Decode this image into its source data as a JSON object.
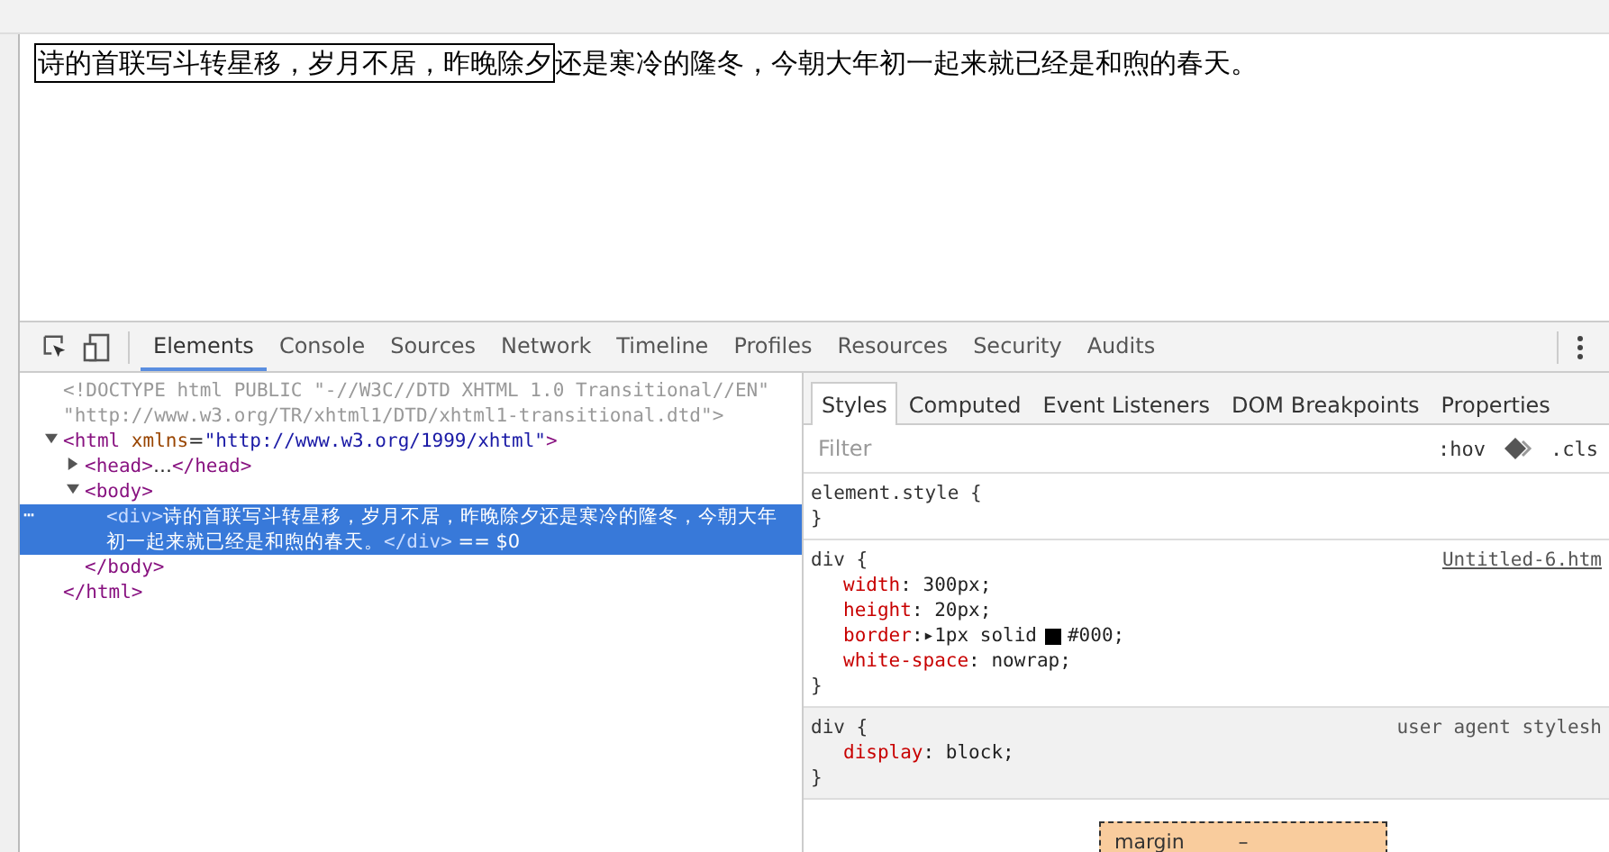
{
  "page": {
    "boxed_text": "诗的首联写斗转星移，岁月不居，昨晚除夕",
    "overflow_text": "还是寒冷的隆冬，今朝大年初一起来就已经是和煦的春天。"
  },
  "devtools": {
    "tabs": [
      {
        "label": "Elements",
        "selected": true
      },
      {
        "label": "Console",
        "selected": false
      },
      {
        "label": "Sources",
        "selected": false
      },
      {
        "label": "Network",
        "selected": false
      },
      {
        "label": "Timeline",
        "selected": false
      },
      {
        "label": "Profiles",
        "selected": false
      },
      {
        "label": "Resources",
        "selected": false
      },
      {
        "label": "Security",
        "selected": false
      },
      {
        "label": "Audits",
        "selected": false
      }
    ],
    "dom": [
      {
        "kind": "doctype",
        "segments": [
          {
            "kind": "doctype",
            "text": "<!DOCTYPE html PUBLIC \"-//W3C//DTD XHTML 1.0 Transitional//EN\" \"http://www.w3.org/TR/xhtml1/DTD/xhtml1-transitional.dtd\">"
          }
        ]
      },
      {
        "kind": "element",
        "expanded": true,
        "selected": false,
        "segments": [
          {
            "kind": "tag",
            "text": "<html"
          },
          {
            "kind": "attr",
            "text": " xmlns"
          },
          {
            "kind": "plain",
            "text": "="
          },
          {
            "kind": "value",
            "text": "\"http://www.w3.org/1999/xhtml\""
          },
          {
            "kind": "tag",
            "text": ">"
          }
        ],
        "close": "</html>",
        "children": [
          {
            "kind": "element",
            "expanded": false,
            "selected": false,
            "segments": [
              {
                "kind": "tag",
                "text": "<head>"
              },
              {
                "kind": "plain",
                "text": "…"
              },
              {
                "kind": "tag",
                "text": "</head>"
              }
            ]
          },
          {
            "kind": "element",
            "expanded": true,
            "selected": false,
            "segments": [
              {
                "kind": "tag",
                "text": "<body>"
              }
            ],
            "close": "</body>",
            "children": [
              {
                "kind": "element",
                "selected": true,
                "gutter": "⋯",
                "segments": [
                  {
                    "kind": "tag",
                    "text": "<div>"
                  },
                  {
                    "kind": "plain",
                    "text": "诗的首联写斗转星移，岁月不居，昨晚除夕还是寒冷的隆冬，今朝大年初一起来就已经是和煦的春天。"
                  },
                  {
                    "kind": "tag",
                    "text": "</div>"
                  },
                  {
                    "kind": "plain",
                    "text": " == $0"
                  }
                ]
              }
            ]
          }
        ]
      }
    ],
    "sidebar_tabs": [
      {
        "label": "Styles",
        "selected": true
      },
      {
        "label": "Computed",
        "selected": false
      },
      {
        "label": "Event Listeners",
        "selected": false
      },
      {
        "label": "DOM Breakpoints",
        "selected": false
      },
      {
        "label": "Properties",
        "selected": false
      }
    ],
    "filter": {
      "placeholder": "Filter",
      "hov": ":hov",
      "cls": ".cls"
    },
    "rules": [
      {
        "selector": "element.style {",
        "user_agent": false,
        "close": "}"
      },
      {
        "selector": "div {",
        "source": "Untitled-6.htm",
        "user_agent": false,
        "declarations": [
          {
            "prop": "width",
            "value": ": 300px;"
          },
          {
            "prop": "height",
            "value": ": 20px;"
          },
          {
            "prop": "border",
            "value": ":▸1px solid",
            "color": "#000000",
            "after": "#000;"
          },
          {
            "prop": "white-space",
            "value": ": nowrap;"
          }
        ],
        "close": "}"
      },
      {
        "selector": "div {",
        "source": "user agent stylesh",
        "user_agent": true,
        "declarations": [
          {
            "prop": "display",
            "value": ": block;"
          }
        ],
        "close": "}"
      }
    ],
    "box_model": {
      "label": "margin",
      "value": "–"
    }
  }
}
